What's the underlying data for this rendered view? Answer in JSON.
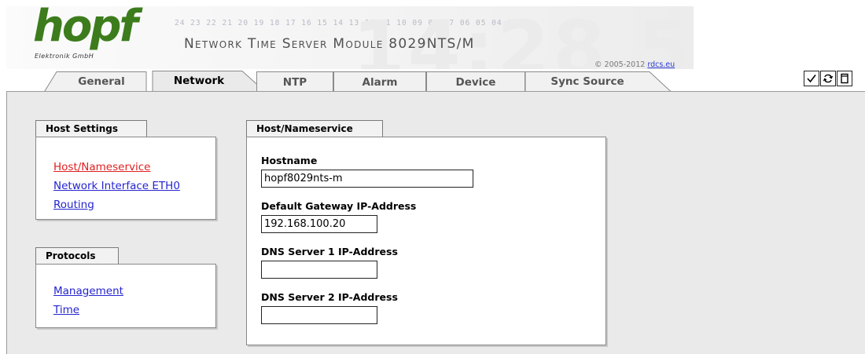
{
  "banner": {
    "logo_text": "hopf",
    "logo_sub": "Elektronik   GmbH",
    "title": "Network Time Server Module 8029NTS/M",
    "copyright_prefix": "© 2005-2012 ",
    "copyright_link": "rdcs.eu",
    "tick_numbers": "24 23 22 21 20 19 18 17 16 15 14 13 12 11 10 09 08 07 06 05 04 01",
    "decor_digits": "14:28 5"
  },
  "tabs": [
    {
      "label": "General"
    },
    {
      "label": "Network",
      "active": true
    },
    {
      "label": "NTP"
    },
    {
      "label": "Alarm"
    },
    {
      "label": "Device"
    },
    {
      "label": "Sync Source"
    }
  ],
  "toolbar_icons": [
    "checkmark-icon",
    "reload-icon",
    "page-icon"
  ],
  "host_settings": {
    "title": "Host Settings",
    "links": [
      {
        "label": "Host/Nameservice",
        "current": true
      },
      {
        "label": "Network Interface ETH0"
      },
      {
        "label": "Routing"
      }
    ]
  },
  "protocols": {
    "title": "Protocols",
    "links": [
      {
        "label": "Management"
      },
      {
        "label": "Time"
      }
    ]
  },
  "host_nameservice": {
    "title": "Host/Nameservice",
    "hostname_label": "Hostname",
    "hostname_value": "hopf8029nts-m",
    "gateway_label": "Default Gateway IP-Address",
    "gateway_value": "192.168.100.20",
    "dns1_label": "DNS Server 1 IP-Address",
    "dns1_value": "",
    "dns2_label": "DNS Server 2 IP-Address",
    "dns2_value": ""
  },
  "colors": {
    "logo_green": "#3c7c1c",
    "link_blue": "#2424d0",
    "link_active_red": "#e02020",
    "content_bg": "#eaeaea"
  }
}
